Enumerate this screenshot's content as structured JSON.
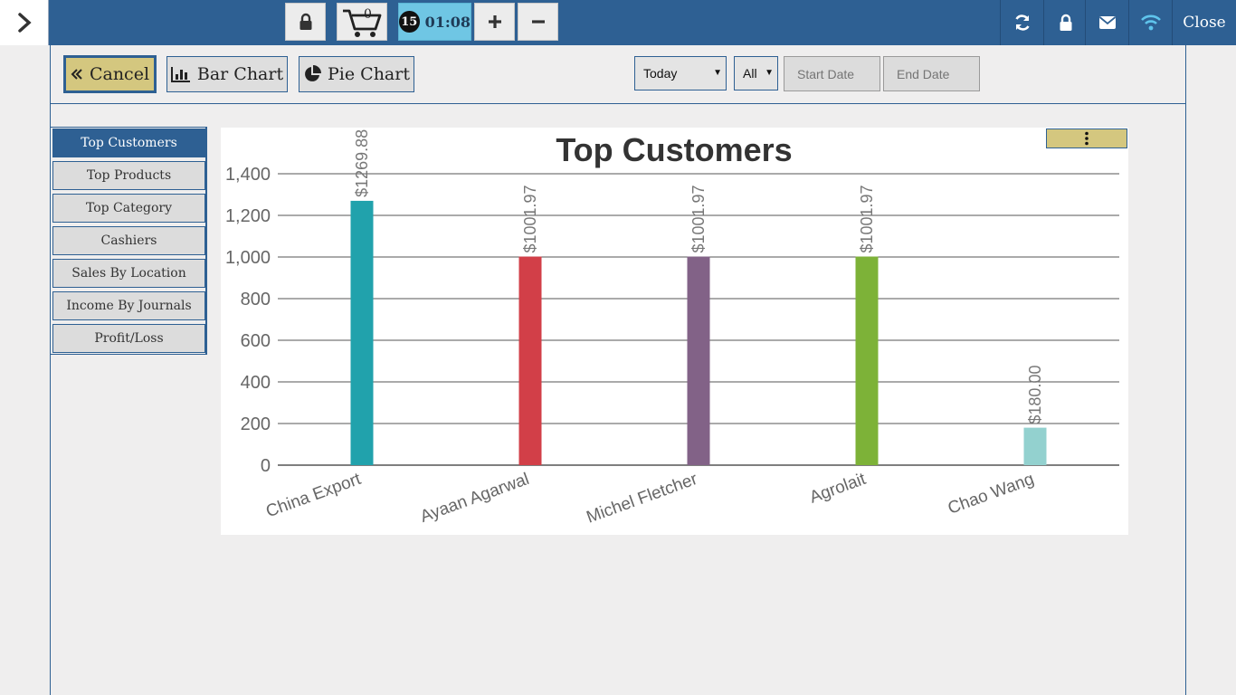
{
  "topbar": {
    "cart_count": "0",
    "timer_badge": "15",
    "timer_value": "01:08",
    "close_label": "Close"
  },
  "toolbar": {
    "cancel_label": "Cancel",
    "bar_chart_label": "Bar Chart",
    "pie_chart_label": "Pie Chart",
    "period_value": "Today",
    "filter_value": "All",
    "start_date_placeholder": "Start Date",
    "end_date_placeholder": "End Date"
  },
  "menu": {
    "items": [
      {
        "label": "Top Customers",
        "active": true
      },
      {
        "label": "Top Products",
        "active": false
      },
      {
        "label": "Top Category",
        "active": false
      },
      {
        "label": "Cashiers",
        "active": false
      },
      {
        "label": "Sales By Location",
        "active": false
      },
      {
        "label": "Income By Journals",
        "active": false
      },
      {
        "label": "Profit/Loss",
        "active": false
      }
    ]
  },
  "colors": {
    "brand": "#2e6093",
    "accent": "#d4c77f",
    "timer": "#6fc6e4"
  },
  "chart_data": {
    "type": "bar",
    "title": "Top Customers",
    "categories": [
      "China Export",
      "Ayaan Agarwal",
      "Michel Fletcher",
      "Agrolait",
      "Chao Wang"
    ],
    "values": [
      1269.88,
      1001.97,
      1001.97,
      1001.97,
      180.0
    ],
    "data_labels": [
      "$1269.88",
      "$1001.97",
      "$1001.97",
      "$1001.97",
      "$180.00"
    ],
    "bar_colors": [
      "#21a2ac",
      "#d23f48",
      "#826287",
      "#7db238",
      "#93d1cf"
    ],
    "ylim": [
      0,
      1400
    ],
    "yticks": [
      0,
      200,
      400,
      600,
      800,
      1000,
      1200,
      1400
    ],
    "ytick_labels": [
      "0",
      "200",
      "400",
      "600",
      "800",
      "1,000",
      "1,200",
      "1,400"
    ],
    "grid": true,
    "legend": "none"
  }
}
